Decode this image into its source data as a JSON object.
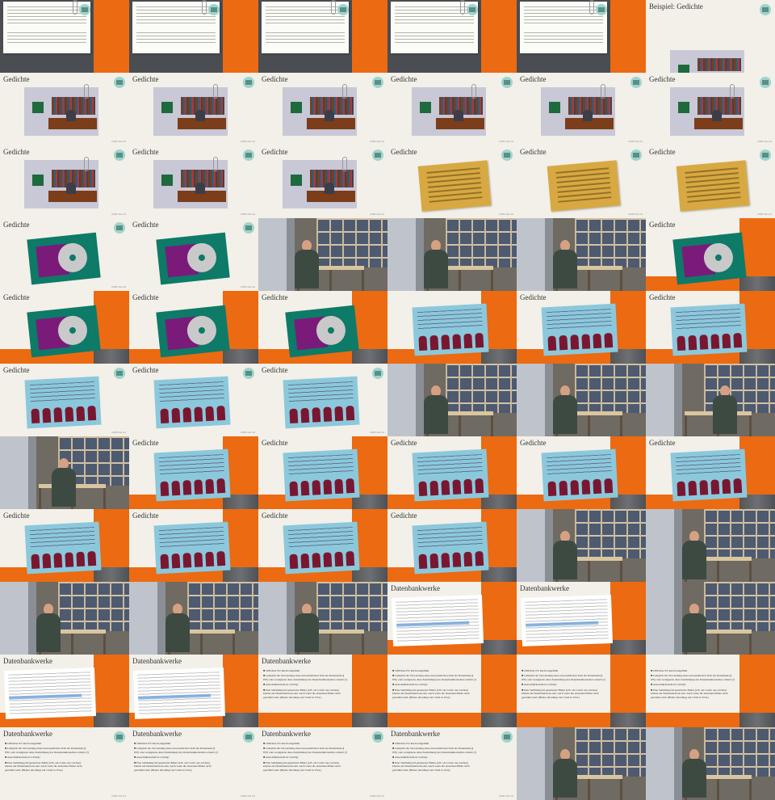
{
  "frames": [
    {
      "kind": "notepad"
    },
    {
      "kind": "notepad"
    },
    {
      "kind": "notepad"
    },
    {
      "kind": "notepad"
    },
    {
      "kind": "notepad"
    },
    {
      "kind": "title",
      "title": "Beispiel: Gedichte"
    },
    {
      "kind": "office",
      "title": "Gedichte"
    },
    {
      "kind": "office",
      "title": "Gedichte"
    },
    {
      "kind": "office",
      "title": "Gedichte"
    },
    {
      "kind": "office",
      "title": "Gedichte"
    },
    {
      "kind": "office",
      "title": "Gedichte"
    },
    {
      "kind": "office",
      "title": "Gedichte"
    },
    {
      "kind": "office",
      "title": "Gedichte"
    },
    {
      "kind": "office",
      "title": "Gedichte"
    },
    {
      "kind": "office",
      "title": "Gedichte"
    },
    {
      "kind": "note",
      "title": "Gedichte"
    },
    {
      "kind": "note",
      "title": "Gedichte"
    },
    {
      "kind": "note",
      "title": "Gedichte"
    },
    {
      "kind": "cd",
      "title": "Gedichte"
    },
    {
      "kind": "cd",
      "title": "Gedichte"
    },
    {
      "kind": "camera",
      "pos": "left"
    },
    {
      "kind": "camera",
      "pos": "left"
    },
    {
      "kind": "camera",
      "pos": "left"
    },
    {
      "kind": "cd",
      "title": "Gedichte",
      "split": true
    },
    {
      "kind": "cd",
      "title": "Gedichte",
      "split": true
    },
    {
      "kind": "cd",
      "title": "Gedichte",
      "split": true
    },
    {
      "kind": "cd",
      "title": "Gedichte",
      "split": true
    },
    {
      "kind": "quote",
      "title": "",
      "split": true
    },
    {
      "kind": "quote",
      "title": "Gedichte",
      "split": true
    },
    {
      "kind": "quote",
      "title": "Gedichte",
      "split": true
    },
    {
      "kind": "quote",
      "title": "Gedichte"
    },
    {
      "kind": "quote",
      "title": "Gedichte"
    },
    {
      "kind": "quote",
      "title": "Gedichte"
    },
    {
      "kind": "camera",
      "pos": "left"
    },
    {
      "kind": "camera",
      "pos": "left"
    },
    {
      "kind": "camera",
      "pos": "right"
    },
    {
      "kind": "camera",
      "pos": "mid"
    },
    {
      "kind": "quote",
      "title": "Gedichte",
      "split": true
    },
    {
      "kind": "quote",
      "title": "Gedichte",
      "split": true
    },
    {
      "kind": "quote",
      "title": "Gedichte",
      "split": true
    },
    {
      "kind": "quote",
      "title": "Gedichte",
      "split": true
    },
    {
      "kind": "quote",
      "title": "Gedichte",
      "split": true
    },
    {
      "kind": "quote",
      "title": "Gedichte",
      "split": true
    },
    {
      "kind": "quote",
      "title": "Gedichte",
      "split": true
    },
    {
      "kind": "quote",
      "title": "Gedichte",
      "split": true
    },
    {
      "kind": "quote",
      "title": "Gedichte",
      "split": true
    },
    {
      "kind": "camera",
      "pos": "left"
    },
    {
      "kind": "camera",
      "pos": "left"
    },
    {
      "kind": "camera",
      "pos": "left"
    },
    {
      "kind": "camera",
      "pos": "left"
    },
    {
      "kind": "camera",
      "pos": "left"
    },
    {
      "kind": "textpage",
      "title": "Datenbankwerke",
      "split": true
    },
    {
      "kind": "textpage",
      "title": "Datenbankwerke",
      "split": true
    },
    {
      "kind": "camera",
      "pos": "left"
    },
    {
      "kind": "textpage",
      "title": "Datenbankwerke",
      "split": true
    },
    {
      "kind": "textpage",
      "title": "Datenbankwerke",
      "split": true
    },
    {
      "kind": "bullets",
      "title": "Datenbankwerke",
      "split": true
    },
    {
      "kind": "bullets",
      "title": "",
      "split": true
    },
    {
      "kind": "bullets",
      "title": "",
      "split": true
    },
    {
      "kind": "bullets",
      "title": "",
      "split": true
    },
    {
      "kind": "bullets",
      "title": "Datenbankwerke"
    },
    {
      "kind": "bullets",
      "title": "Datenbankwerke"
    },
    {
      "kind": "bullets",
      "title": "Datenbankwerke"
    },
    {
      "kind": "bullets",
      "title": "Datenbankwerke"
    },
    {
      "kind": "camera",
      "pos": "left"
    },
    {
      "kind": "camera",
      "pos": "left"
    }
  ],
  "bullet_text": [
    "1996 über EU Recht eingeführt",
    "Lediglich die Verwendung eines unwesentlichen Teils der Datenbank (§ 87b) oder wenigstens ohne Zustimmung des Datenbankherstellers erlaubt (!)",
    "Auswahlkriterium ist wichtig!",
    "Eine Sammlung KI generierter Bilder (z.B. ein Comic aus solchen) könnte ein Datenbankwerk sein. Auch wenn die einzelnen Bilder nicht geschützt sind. (Bisher allerdings nur Urteil in USA)"
  ],
  "footer": "CCBY-SA 4.0"
}
